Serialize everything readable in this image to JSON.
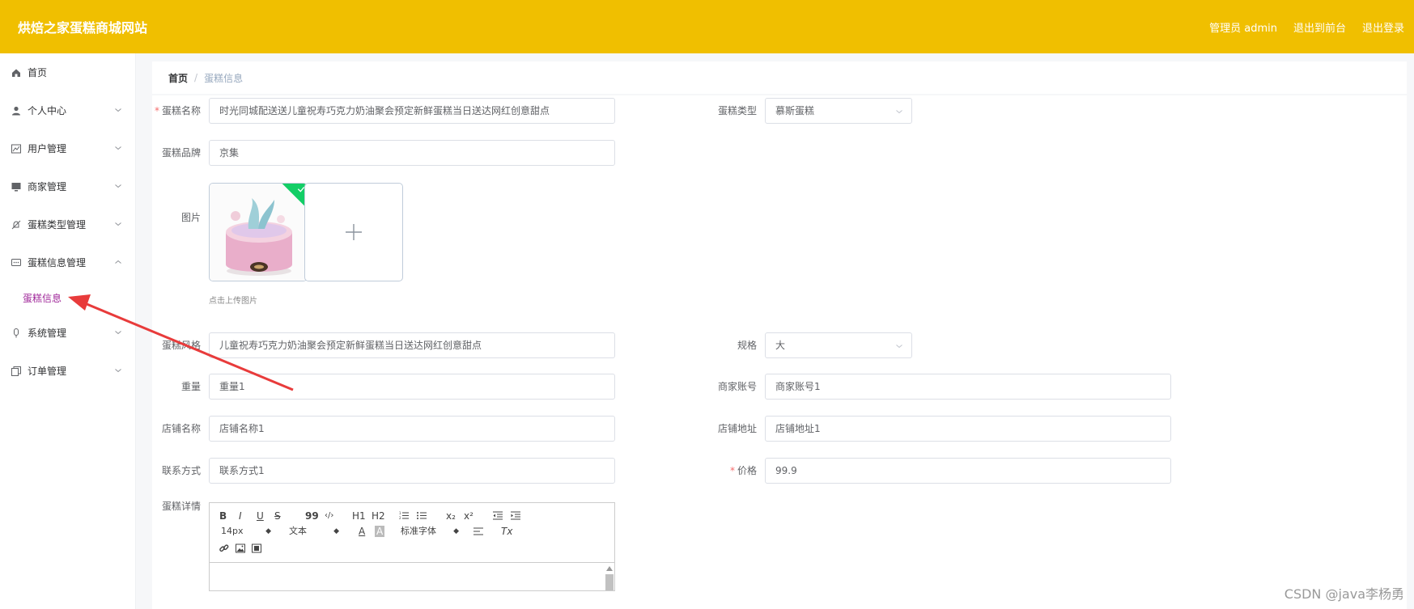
{
  "header": {
    "brand": "烘焙之家蛋糕商城网站",
    "admin_label": "管理员 admin",
    "to_front_label": "退出到前台",
    "logout_label": "退出登录",
    "bg_color": "#f0bf00"
  },
  "sidebar": {
    "items": [
      {
        "label": "首页",
        "icon": "home-icon"
      },
      {
        "label": "个人中心",
        "icon": "user-icon"
      },
      {
        "label": "用户管理",
        "icon": "chart-icon"
      },
      {
        "label": "商家管理",
        "icon": "monitor-icon"
      },
      {
        "label": "蛋糕类型管理",
        "icon": "bell-off-icon"
      },
      {
        "label": "蛋糕信息管理",
        "icon": "chat-dots-icon"
      },
      {
        "label": "系统管理",
        "icon": "mic-icon"
      },
      {
        "label": "订单管理",
        "icon": "copy-icon"
      }
    ],
    "active_sub": "蛋糕信息"
  },
  "breadcrumb": {
    "home": "首页",
    "sep": "/",
    "current": "蛋糕信息"
  },
  "form": {
    "cake_name": {
      "label": "蛋糕名称",
      "value": "时光同城配送送儿童祝寿巧克力奶油聚会预定新鲜蛋糕当日送达网红创意甜点"
    },
    "cake_type": {
      "label": "蛋糕类型",
      "value": "慕斯蛋糕"
    },
    "cake_brand": {
      "label": "蛋糕品牌",
      "value": "京集"
    },
    "image": {
      "label": "图片",
      "tip": "点击上传图片"
    },
    "cake_style": {
      "label": "蛋糕风格",
      "value": "儿童祝寿巧克力奶油聚会预定新鲜蛋糕当日送达网红创意甜点"
    },
    "spec": {
      "label": "规格",
      "value": "大"
    },
    "weight": {
      "label": "重量",
      "value": "重量1"
    },
    "merchant_account": {
      "label": "商家账号",
      "value": "商家账号1"
    },
    "shop_name": {
      "label": "店铺名称",
      "value": "店铺名称1"
    },
    "shop_address": {
      "label": "店铺地址",
      "value": "店铺地址1"
    },
    "contact": {
      "label": "联系方式",
      "value": "联系方式1"
    },
    "price": {
      "label": "价格",
      "value": "99.9"
    },
    "details": {
      "label": "蛋糕详情"
    },
    "required_mark": "*"
  },
  "editor": {
    "font_size": "14px",
    "text_type": "文本",
    "font_family": "标准字体",
    "b": "B",
    "i": "I",
    "u": "U",
    "s": "S",
    "quote": "99",
    "code": "‹/›",
    "h1": "H1",
    "h2": "H2",
    "sub": "x₂",
    "sup": "x²",
    "color_a": "A",
    "bg_a": "A",
    "clear": "Tx"
  },
  "watermark": "CSDN @java李杨勇"
}
